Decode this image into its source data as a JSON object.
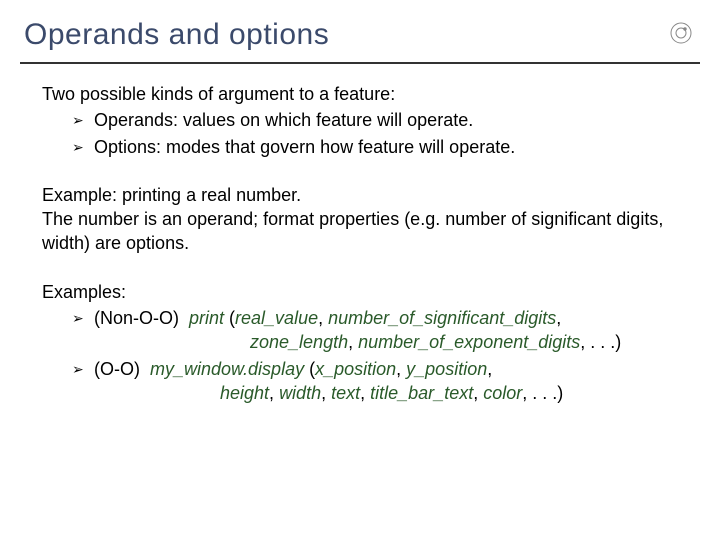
{
  "title": "Operands and options",
  "intro": "Two possible kinds of argument to a feature:",
  "bullets": [
    "Operands: values on which feature will operate.",
    "Options: modes that govern how feature will operate."
  ],
  "example_para1": "Example: printing a real number.",
  "example_para2": "The number is an operand; format properties (e.g. number of significant digits, width) are options.",
  "examples_label": "Examples:",
  "ex1": {
    "label": "(Non-O-O)  ",
    "fn": "print",
    "args_open": " (",
    "a1": "real_value",
    "sep": ", ",
    "a2": "number_of_significant_digits",
    "cont_a3": "zone_length",
    "cont_a4": "number_of_exponent_digits",
    "close": ", . . .)"
  },
  "ex2": {
    "label": "(O-O)  ",
    "call": "my_window.",
    "fn": "display",
    "args_open": " (",
    "a1": "x_position",
    "sep": ", ",
    "a2": "y_position",
    "cont_a3": "height",
    "cont_a4": "width",
    "cont_a5": "text",
    "cont_a6": "title_bar_text",
    "cont_a7": "color",
    "close": ", . . .)"
  },
  "bullet_glyph": "➢"
}
